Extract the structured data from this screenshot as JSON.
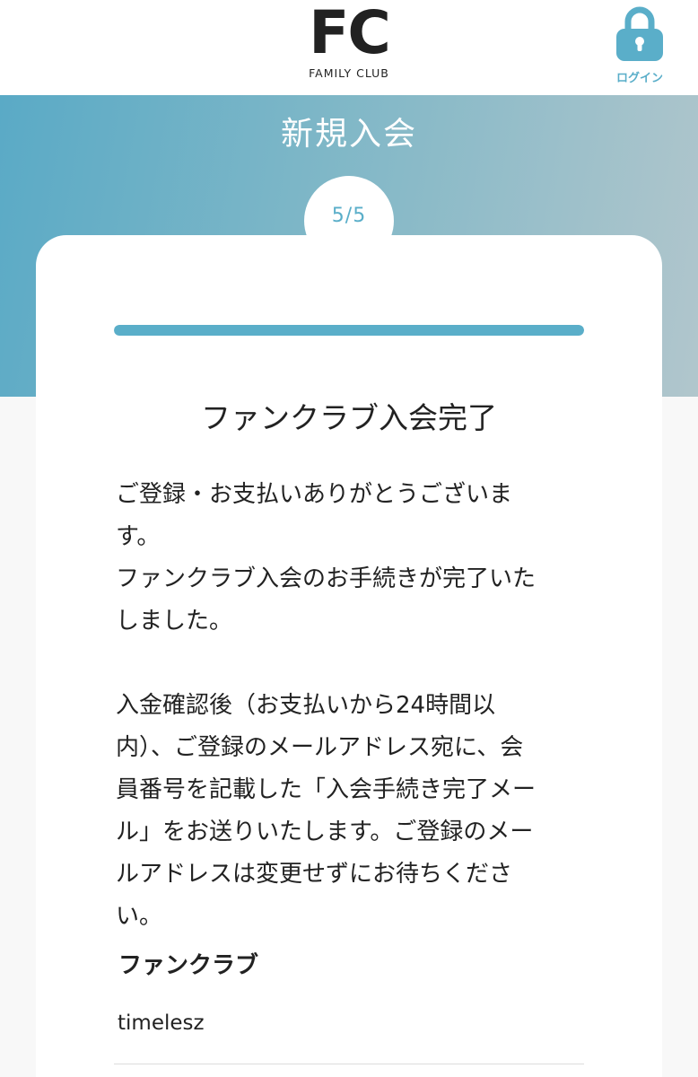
{
  "header": {
    "logo_mark": "FC",
    "logo_sub": "FAMILY CLUB",
    "login_label": "ログイン",
    "login_icon": "lock-icon"
  },
  "hero": {
    "title": "新規入会"
  },
  "steps": {
    "label": "5/5",
    "current": 5,
    "total": 5
  },
  "main": {
    "title": "ファンクラブ入会完了",
    "message": "ご登録・お支払いありがとうございま\nす。\nファンクラブ入会のお手続きが完了いた\nしました。\n\n入金確認後（お支払いから24時間以\n内）、ご登録のメールアドレス宛に、会\n員番号を記載した「入会手続き完了メー\nル」をお送りいたします。ご登録のメー\nルアドレスは変更せずにお待ちくださ\nい。"
  },
  "fanclub": {
    "label": "ファンクラブ",
    "value": "timelesz"
  },
  "colors": {
    "accent": "#5aaec9",
    "hero_start": "#5aaac6",
    "hero_end": "#b1c6cc",
    "card": "#ffffff",
    "text": "#222222"
  }
}
